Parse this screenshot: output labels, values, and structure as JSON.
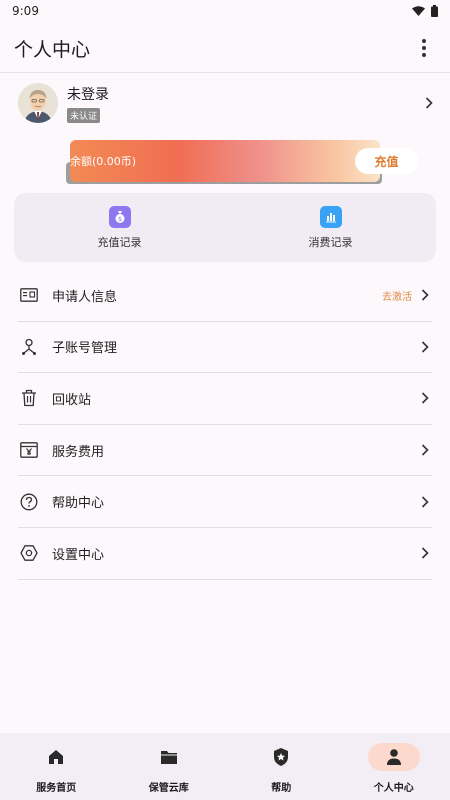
{
  "status_bar": {
    "time": "9:09"
  },
  "app_bar": {
    "title": "个人中心"
  },
  "profile": {
    "name": "未登录",
    "badge": "未认证"
  },
  "balance": {
    "text": "余额(0.00币)",
    "recharge_label": "充值"
  },
  "records": [
    {
      "label": "充值记录",
      "icon": "money-bag-icon",
      "color": "#8e78f0"
    },
    {
      "label": "消费记录",
      "icon": "bar-chart-icon",
      "color": "#3aa2f5"
    }
  ],
  "menu": [
    {
      "label": "申请人信息",
      "hint": "去激活",
      "icon": "id-card-icon"
    },
    {
      "label": "子账号管理",
      "hint": "",
      "icon": "org-tree-icon"
    },
    {
      "label": "回收站",
      "hint": "",
      "icon": "trash-icon"
    },
    {
      "label": "服务费用",
      "hint": "",
      "icon": "yen-icon"
    },
    {
      "label": "帮助中心",
      "hint": "",
      "icon": "help-icon"
    },
    {
      "label": "设置中心",
      "hint": "",
      "icon": "settings-icon"
    }
  ],
  "bottom_nav": [
    {
      "label": "服务首页",
      "icon": "home-icon",
      "active": false
    },
    {
      "label": "保管云库",
      "icon": "folder-icon",
      "active": false
    },
    {
      "label": "帮助",
      "icon": "shield-star-icon",
      "active": false
    },
    {
      "label": "个人中心",
      "icon": "person-icon",
      "active": true
    }
  ],
  "colors": {
    "accent": "#e07a30",
    "nav_active": "#fbd9cc",
    "background": "#fdf8fc"
  }
}
